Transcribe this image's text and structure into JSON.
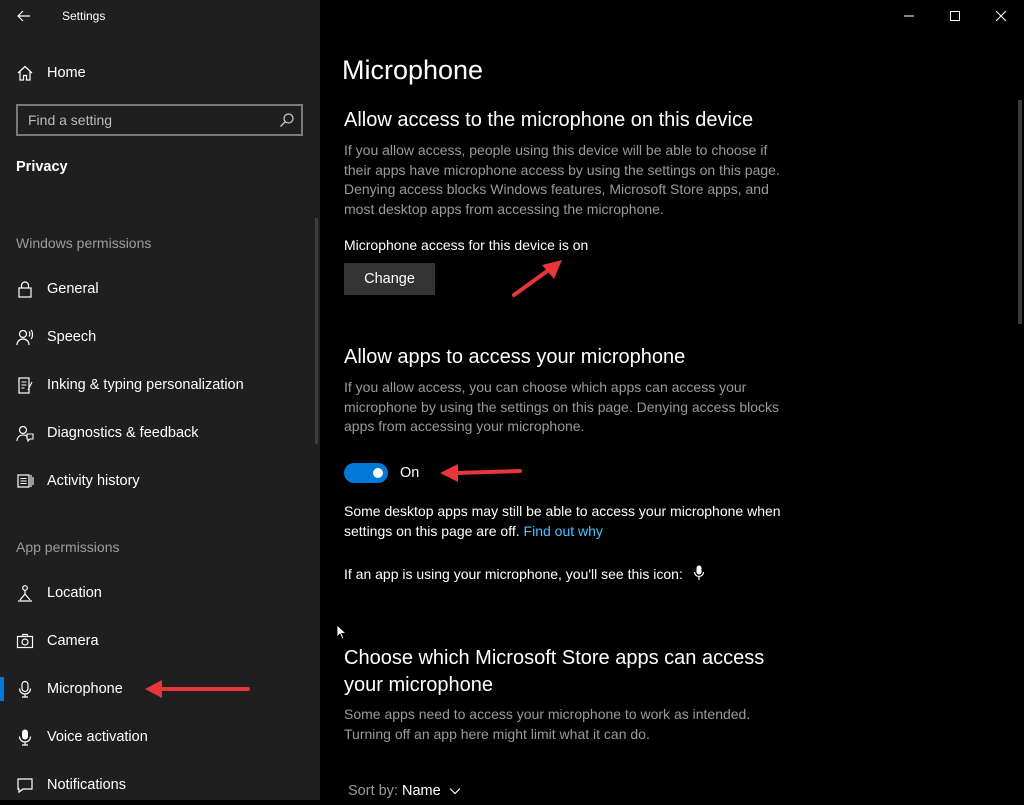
{
  "window": {
    "app_title": "Settings",
    "controls": [
      "minimize-icon",
      "maximize-icon",
      "close-icon"
    ]
  },
  "sidebar": {
    "home_label": "Home",
    "search_placeholder": "Find a setting",
    "category": "Privacy",
    "windows_permissions_header": "Windows permissions",
    "windows_permissions": [
      {
        "label": "General",
        "icon": "lock-icon"
      },
      {
        "label": "Speech",
        "icon": "speech-icon"
      },
      {
        "label": "Inking & typing personalization",
        "icon": "inking-icon"
      },
      {
        "label": "Diagnostics & feedback",
        "icon": "diagnostics-icon"
      },
      {
        "label": "Activity history",
        "icon": "activity-history-icon"
      }
    ],
    "app_permissions_header": "App permissions",
    "app_permissions": [
      {
        "label": "Location",
        "icon": "location-icon"
      },
      {
        "label": "Camera",
        "icon": "camera-icon"
      },
      {
        "label": "Microphone",
        "icon": "microphone-icon",
        "selected": true
      },
      {
        "label": "Voice activation",
        "icon": "voice-activation-icon"
      },
      {
        "label": "Notifications",
        "icon": "notifications-icon"
      }
    ]
  },
  "main": {
    "page_title": "Microphone",
    "device_section": {
      "heading": "Allow access to the microphone on this device",
      "description": "If you allow access, people using this device will be able to choose if their apps have microphone access by using the settings on this page. Denying access blocks Windows features, Microsoft Store apps, and most desktop apps from accessing the microphone.",
      "status": "Microphone access for this device is on",
      "change_button": "Change"
    },
    "apps_section": {
      "heading": "Allow apps to access your microphone",
      "description": "If you allow access, you can choose which apps can access your microphone by using the settings on this page. Denying access blocks apps from accessing your microphone.",
      "toggle_state": "On",
      "toggle_on": true,
      "desktop_note": "Some desktop apps may still be able to access your microphone when settings on this page are off.",
      "find_out_link": "Find out why",
      "icon_note": "If an app is using your microphone, you'll see this icon:"
    },
    "store_section": {
      "heading": "Choose which Microsoft Store apps can access your microphone",
      "description": "Some apps need to access your microphone to work as intended. Turning off an app here might limit what it can do.",
      "sort_label": "Sort by:",
      "sort_value": "Name"
    }
  },
  "colors": {
    "sidebar_bg": "#1f1f1f",
    "main_bg": "#000000",
    "accent": "#0078d7",
    "link": "#4cc2ff",
    "annotation_arrow": "#e8363a"
  }
}
